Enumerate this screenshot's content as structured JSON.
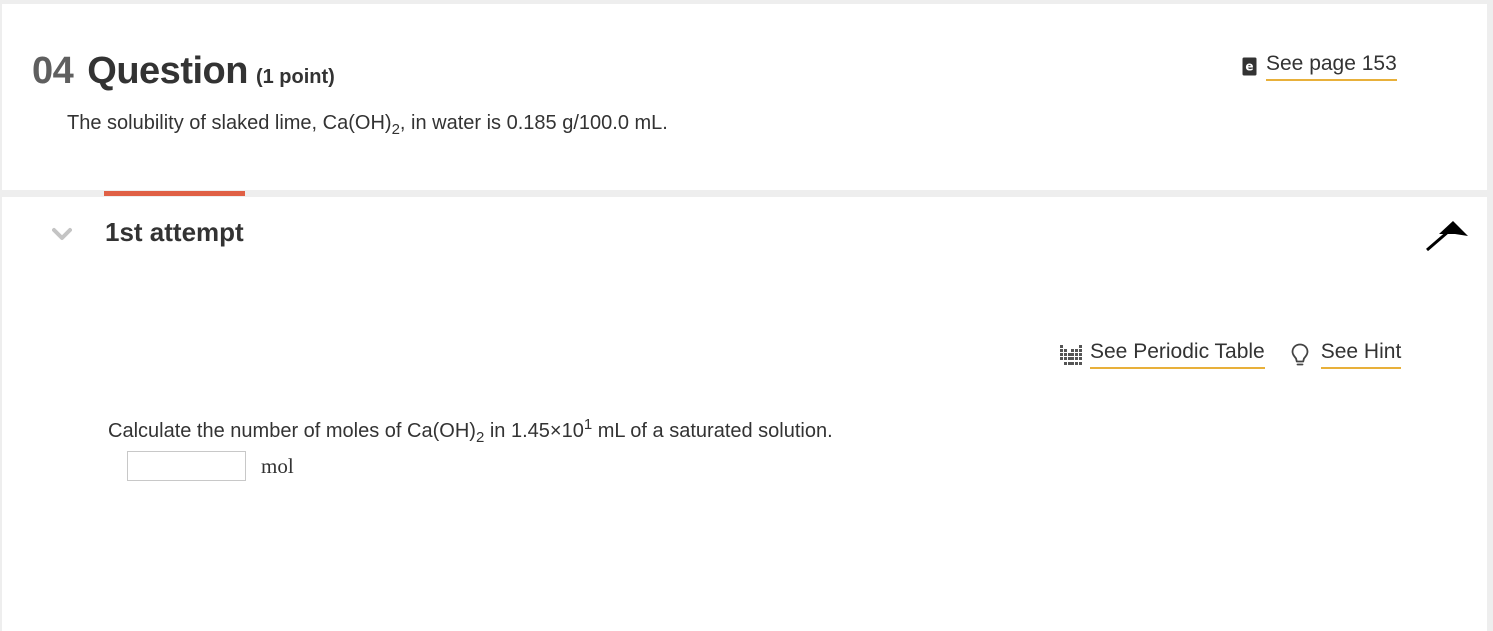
{
  "question": {
    "number": "04",
    "title": "Question",
    "points": "(1 point)",
    "statement": {
      "part1": "The solubility of slaked lime, Ca(OH)",
      "sub": "2",
      "part2": ", in water is 0.185 g/100.0 mL."
    },
    "see_page_label": "See page 153",
    "ebook_icon": "ebook-icon"
  },
  "attempt": {
    "label": "1st attempt",
    "indicator_color": "#e06045",
    "tools": {
      "periodic_table_label": "See Periodic Table",
      "hint_label": "See Hint"
    },
    "prompt": {
      "part1": "Calculate the number of moles of Ca(OH)",
      "sub": "2",
      "part2": " in 1.45×10",
      "sup": "1",
      "part3": " mL of a saturated solution."
    },
    "answer": {
      "value": "",
      "placeholder": "",
      "unit": "mol"
    }
  },
  "colors": {
    "link_underline": "#e8b03a",
    "accent": "#e06045"
  }
}
